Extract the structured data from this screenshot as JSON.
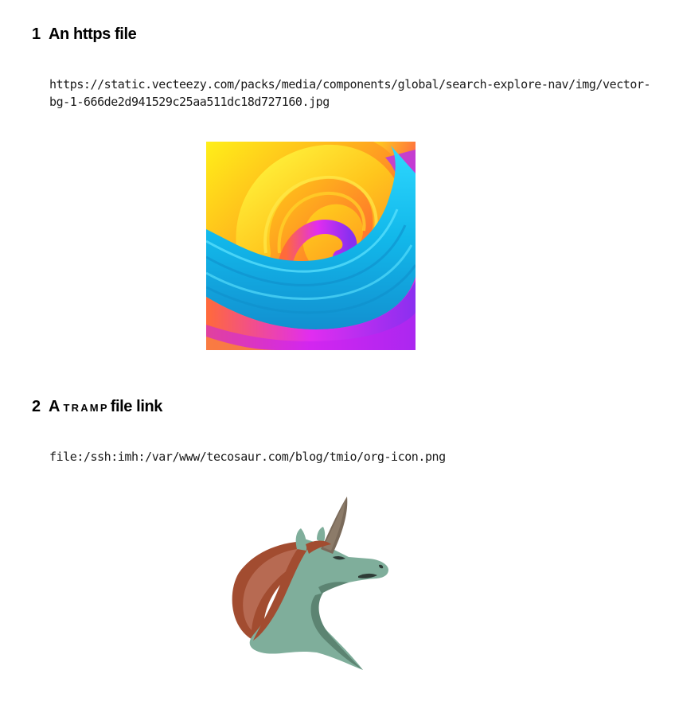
{
  "sections": [
    {
      "number": "1",
      "title": "An https file",
      "link_line1": "https://static.vecteezy.com/packs/media/components/global/search-explore-nav/img/vector-",
      "link_line2": "bg-1-666de2d941529c25aa511dc18d727160.jpg"
    },
    {
      "number": "2",
      "title_prefix": "A",
      "title_smallcaps": "TRAMP",
      "title_suffix": "file link",
      "link_line1": "file:/ssh:imh:/var/www/tecosaur.com/blog/tmio/org-icon.png"
    }
  ],
  "icons": {
    "image1": "swirl-gradient-image",
    "image2": "org-mode-unicorn-icon"
  }
}
